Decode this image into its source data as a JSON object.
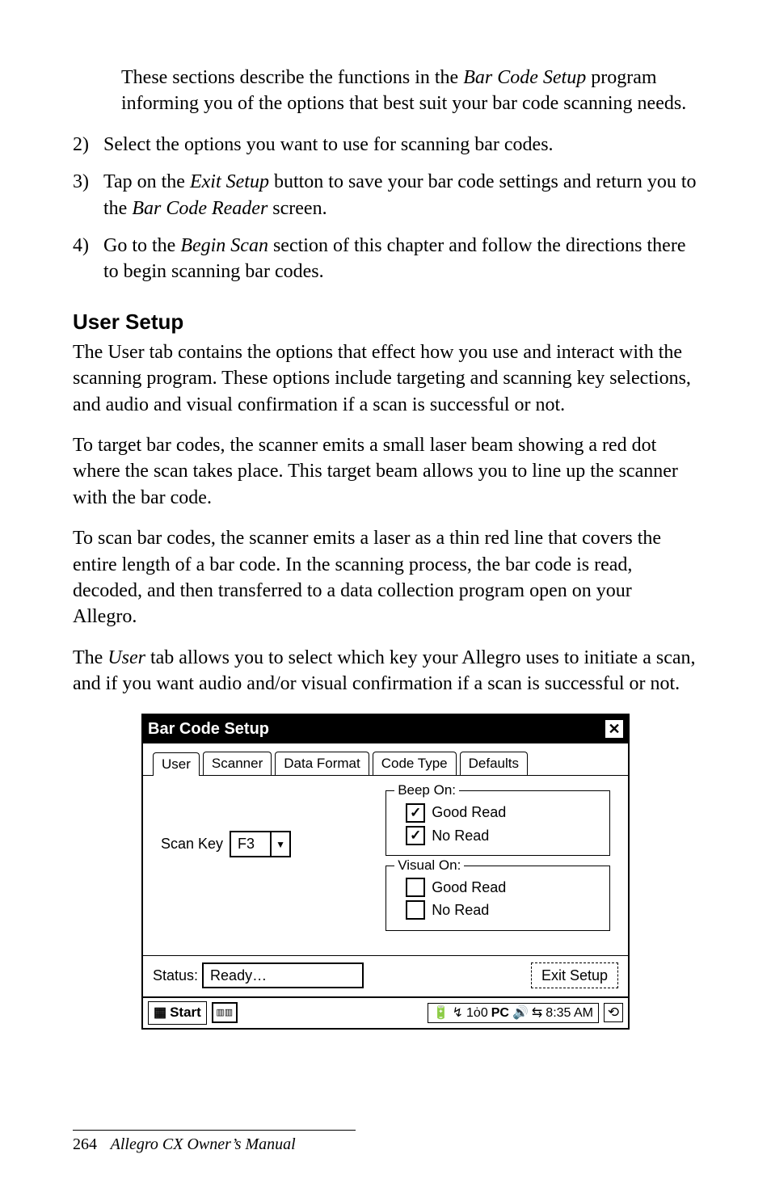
{
  "intro_paragraph": "These sections describe the functions in the ",
  "intro_em": "Bar Code Setup",
  "intro_paragraph_after": " program informing you of the options that best suit your bar code scanning needs.",
  "list": [
    {
      "marker": "2)",
      "pre": "Select the options you want to use for scanning bar codes."
    },
    {
      "marker": "3)",
      "pre": "Tap on the ",
      "em": "Exit Setup",
      "mid": " button to save your bar code settings and return you to the ",
      "em2": "Bar Code Reader",
      "post": " screen."
    },
    {
      "marker": "4)",
      "pre": "Go to the ",
      "em": "Begin Scan",
      "post": " section of this chapter and follow the directions there to begin scanning bar codes."
    }
  ],
  "heading": "User Setup",
  "para1": "The User tab contains the options that effect how you use and interact with the scanning program. These options include targeting and scanning key selections, and audio and visual confirmation if a scan is successful or not.",
  "para2": "To target bar codes, the scanner emits a small laser beam showing a red dot where the scan takes place. This target beam allows you to line up the scanner with the bar code.",
  "para3": "To scan bar codes, the scanner emits a laser as a thin red line that covers the entire length of a bar code. In the scanning process, the bar code is read, decoded, and then transferred to a data collection program open on your Allegro.",
  "para4_pre": "The ",
  "para4_em": "User",
  "para4_post": " tab allows you to select which key your Allegro uses to initiate a scan, and if you want audio and/or visual confirmation if a scan is successful or not.",
  "dialog": {
    "title": "Bar Code Setup",
    "close": "✕",
    "tabs": [
      "User",
      "Scanner",
      "Data Format",
      "Code Type",
      "Defaults"
    ],
    "scan_key_label": "Scan Key",
    "scan_key_value": "F3",
    "group_beep": "Beep On:",
    "group_visual": "Visual On:",
    "chk_good_read": "Good Read",
    "chk_no_read": "No Read",
    "chk_good_read_v": "Good Read",
    "chk_no_read_v": "No Read",
    "status_label": "Status:",
    "status_value": "Ready…",
    "exit_label": "Exit Setup",
    "start_label": "Start",
    "tray_pc": "PC",
    "tray_100": "1ȯ0",
    "tray_time": "8:35 AM"
  },
  "footer": {
    "page": "264",
    "title": "Allegro CX Owner’s Manual"
  }
}
